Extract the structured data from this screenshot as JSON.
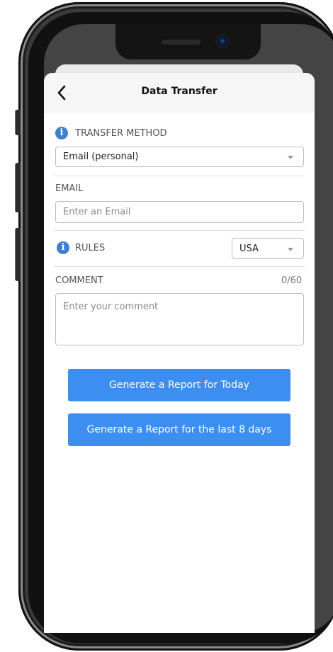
{
  "navigation": {
    "title": "Data Transfer",
    "back_icon": "chevron-left-icon"
  },
  "transfer_method": {
    "label": "TRANSFER METHOD",
    "selected": "Email (personal)",
    "icon": "info-icon"
  },
  "email": {
    "label": "EMAIL",
    "placeholder": "Enter an Email",
    "value": ""
  },
  "rules": {
    "label": "RULES",
    "selected": "USA",
    "icon": "info-icon"
  },
  "comment": {
    "label": "COMMENT",
    "counter": "0/60",
    "placeholder": "Enter your comment",
    "value": ""
  },
  "actions": {
    "report_today": "Generate a Report for Today",
    "report_last_8_days": "Generate a Report for the last 8 days"
  },
  "colors": {
    "accent": "#3d8ef1",
    "info_icon": "#3d7fd6",
    "nav_background": "#f6f6f6"
  }
}
